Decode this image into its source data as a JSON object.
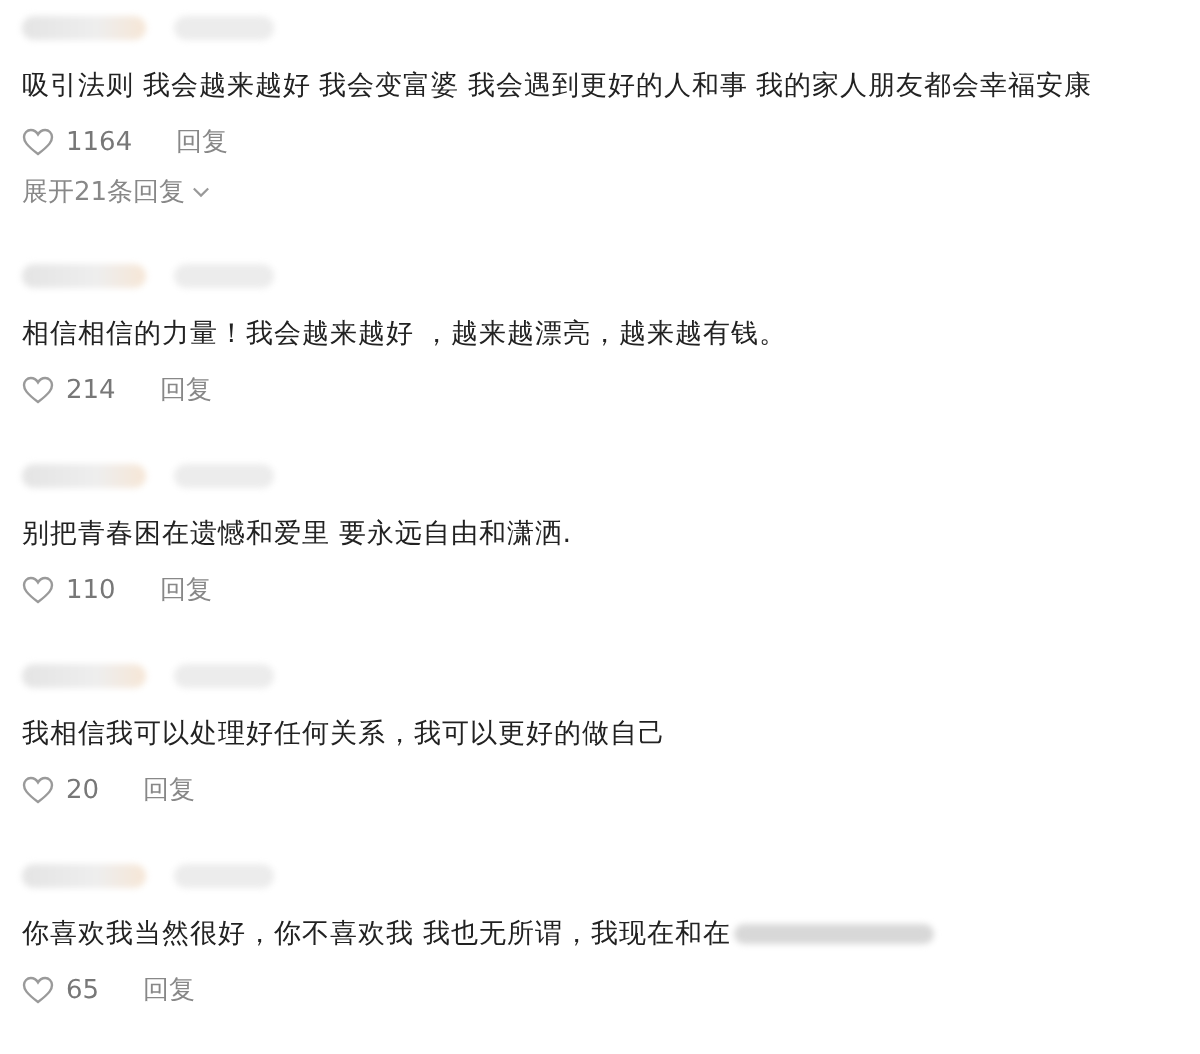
{
  "comments": [
    {
      "text": "吸引法则 我会越来越好 我会变富婆 我会遇到更好的人和事 我的家人朋友都会幸福安康",
      "likes": "1164",
      "reply": "回复",
      "replies_link": "展开21条回复"
    },
    {
      "text": "相信相信的力量！我会越来越好 ，越来越漂亮，越来越有钱。",
      "likes": "214",
      "reply": "回复"
    },
    {
      "text": "别把青春困在遗憾和爱里 要永远自由和潇洒.",
      "likes": "110",
      "reply": "回复"
    },
    {
      "text": "我相信我可以处理好任何关系，我可以更好的做自己",
      "likes": "20",
      "reply": "回复"
    },
    {
      "text": "你喜欢我当然很好，你不喜欢我 我也无所谓，我现在和在",
      "likes": "65",
      "reply": "回复",
      "text_blurred": true
    }
  ]
}
